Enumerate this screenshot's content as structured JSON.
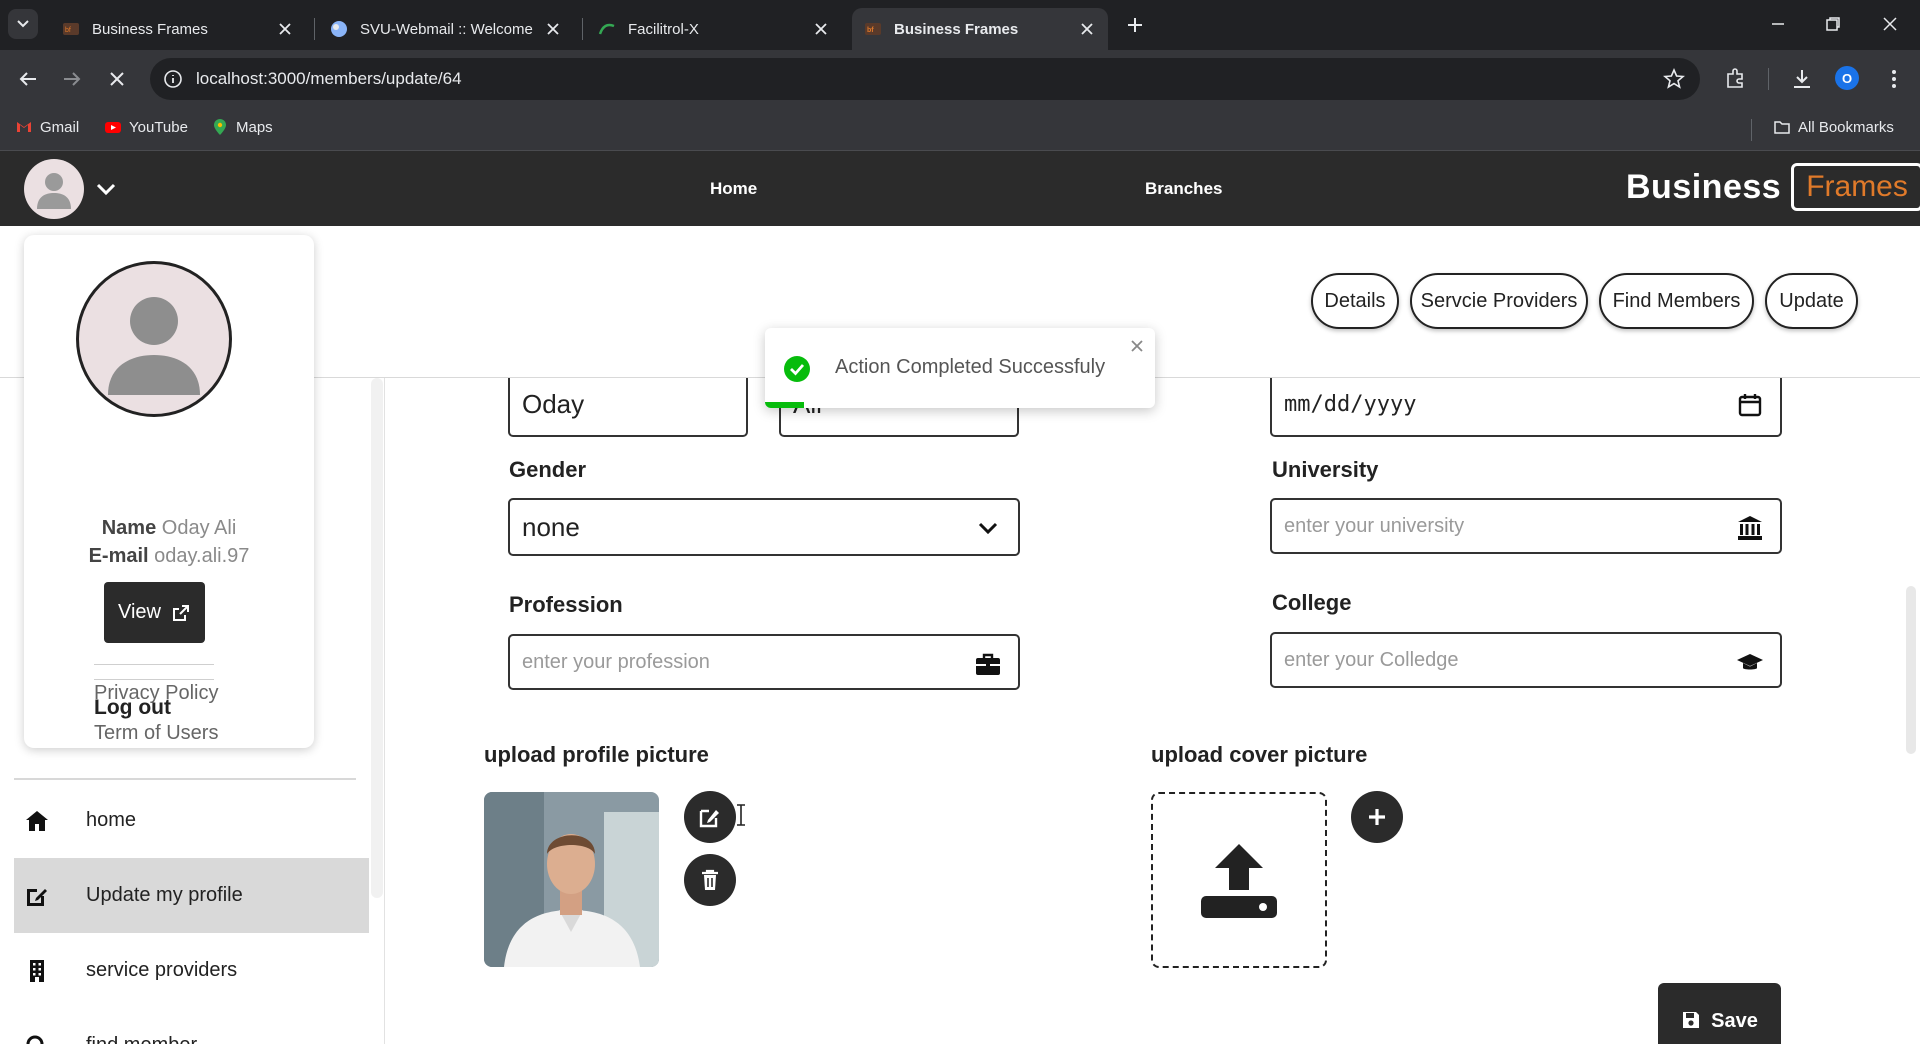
{
  "browser": {
    "tabs": [
      {
        "title": "Business Frames",
        "active": false
      },
      {
        "title": "SVU-Webmail :: Welcome",
        "active": false
      },
      {
        "title": "Facilitrol-X",
        "active": false
      },
      {
        "title": "Business Frames",
        "active": true
      }
    ],
    "url": "localhost:3000/members/update/64",
    "profile_initial": "O",
    "bookmarks": [
      "Gmail",
      "YouTube",
      "Maps"
    ],
    "all_bookmarks": "All Bookmarks"
  },
  "header": {
    "nav": [
      "Home",
      "Branches"
    ],
    "brand_word": "Business",
    "brand_frames": "Frames",
    "accent": "#e07a2a"
  },
  "subnav": [
    "Details",
    "Servcie Providers",
    "Find Members",
    "Update"
  ],
  "profile_card": {
    "name_label": "Name",
    "name_value": "Oday Ali",
    "email_label": "E-mail",
    "email_value": "oday.ali.97",
    "view_label": "View",
    "links": [
      "Privacy Policy",
      "Term of Users"
    ],
    "logout": "Log out"
  },
  "sidebar": {
    "items": [
      {
        "label": "home",
        "icon": "home-icon",
        "active": false
      },
      {
        "label": "Update my profile",
        "icon": "edit-icon",
        "active": true
      },
      {
        "label": "service providers",
        "icon": "building-icon",
        "active": false
      },
      {
        "label": "find member",
        "icon": "search-icon",
        "active": false
      }
    ]
  },
  "form": {
    "first_name": "Oday",
    "last_name": "Ali",
    "birthdate_placeholder": "mm/dd/yyyy",
    "gender_label": "Gender",
    "gender_value": "none",
    "university_label": "University",
    "university_placeholder": "enter your university",
    "profession_label": "Profession",
    "profession_placeholder": "enter your profession",
    "college_label": "College",
    "college_placeholder": "enter your Colledge",
    "upload_profile_label": "upload profile picture",
    "upload_cover_label": "upload cover picture",
    "save_label": "Save"
  },
  "toast": {
    "message": "Action Completed Successfuly",
    "status_color": "#07bc0c",
    "progress": 0.1
  }
}
